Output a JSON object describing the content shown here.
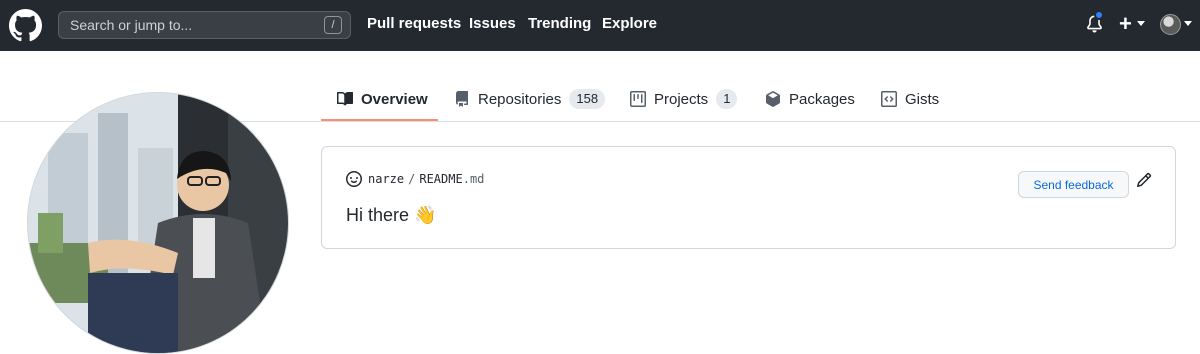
{
  "header": {
    "logo_icon": "github-mark-icon",
    "search_placeholder": "Search or jump to...",
    "search_shortcut": "/",
    "nav": [
      "Pull requests",
      "Issues",
      "Trending",
      "Explore"
    ],
    "notification_icon": "bell-icon",
    "create_icon": "plus-icon",
    "avatar_icon": "user-avatar"
  },
  "tabs": [
    {
      "label": "Overview",
      "icon": "book-icon",
      "active": true
    },
    {
      "label": "Repositories",
      "icon": "repo-icon",
      "count": "158"
    },
    {
      "label": "Projects",
      "icon": "project-icon",
      "count": "1"
    },
    {
      "label": "Packages",
      "icon": "package-icon"
    },
    {
      "label": "Gists",
      "icon": "code-square-icon"
    }
  ],
  "readme": {
    "icon": "smiley-icon",
    "owner": "narze",
    "separator": "/",
    "filename": "README",
    "extension": ".md",
    "feedback_label": "Send feedback",
    "edit_icon": "pencil-icon",
    "greeting": "Hi there 👋"
  },
  "colors": {
    "header_bg": "#24292f",
    "active_tab_underline": "#fd8c73",
    "link_blue": "#0969da",
    "notification_dot": "#2f81f7"
  }
}
